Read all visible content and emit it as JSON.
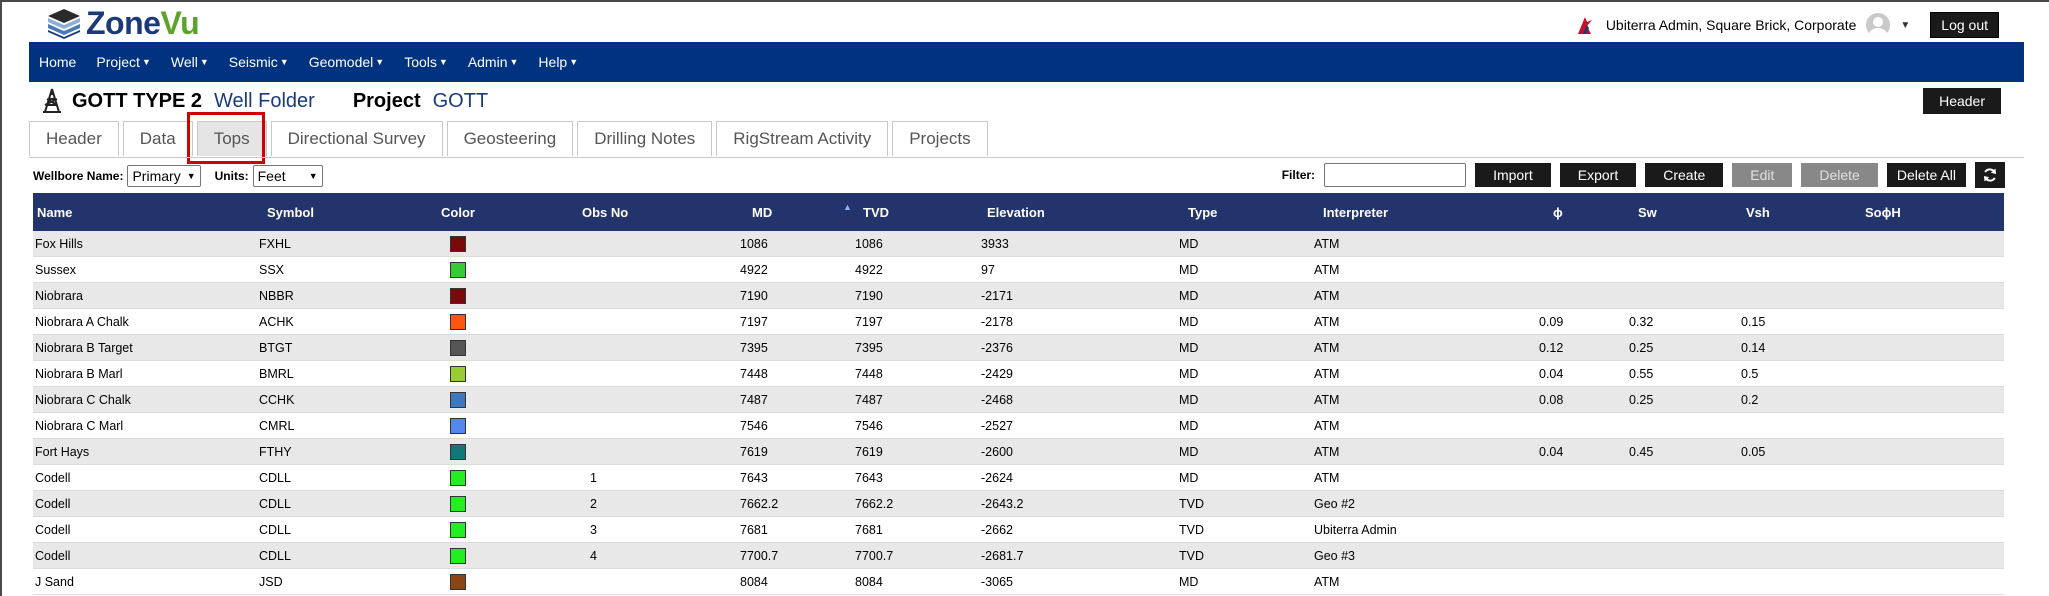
{
  "app": {
    "logo_part1": "Zone",
    "logo_part2": "Vu",
    "user_label": "Ubiterra Admin, Square Brick, Corporate",
    "logout_label": "Log out"
  },
  "nav": [
    {
      "label": "Home",
      "dropdown": false
    },
    {
      "label": "Project",
      "dropdown": true
    },
    {
      "label": "Well",
      "dropdown": true
    },
    {
      "label": "Seismic",
      "dropdown": true
    },
    {
      "label": "Geomodel",
      "dropdown": true
    },
    {
      "label": "Tools",
      "dropdown": true
    },
    {
      "label": "Admin",
      "dropdown": true
    },
    {
      "label": "Help",
      "dropdown": true
    }
  ],
  "title": {
    "well_name": "GOTT TYPE 2",
    "well_folder": "Well Folder",
    "project_label": "Project",
    "project_name": "GOTT",
    "header_button": "Header"
  },
  "tabs": [
    {
      "label": "Header",
      "active": false
    },
    {
      "label": "Data",
      "active": false
    },
    {
      "label": "Tops",
      "active": true
    },
    {
      "label": "Directional Survey",
      "active": false
    },
    {
      "label": "Geosteering",
      "active": false
    },
    {
      "label": "Drilling Notes",
      "active": false
    },
    {
      "label": "RigStream Activity",
      "active": false
    },
    {
      "label": "Projects",
      "active": false
    }
  ],
  "controls": {
    "wellbore_label": "Wellbore Name:",
    "wellbore_value": "Primary",
    "units_label": "Units:",
    "units_value": "Feet",
    "filter_label": "Filter:",
    "filter_value": "",
    "buttons": [
      {
        "label": "Import",
        "enabled": true
      },
      {
        "label": "Export",
        "enabled": true
      },
      {
        "label": "Create",
        "enabled": true
      },
      {
        "label": "Edit",
        "enabled": false
      },
      {
        "label": "Delete",
        "enabled": false
      },
      {
        "label": "Delete All",
        "enabled": true
      }
    ]
  },
  "table": {
    "columns": [
      "Name",
      "Symbol",
      "Color",
      "Obs No",
      "MD",
      "TVD",
      "Elevation",
      "Type",
      "Interpreter",
      "ϕ",
      "Sw",
      "Vsh",
      "SoϕH"
    ],
    "sorted_column": "TVD",
    "rows": [
      {
        "name": "Fox Hills",
        "symbol": "FXHL",
        "color": "#7a0a0a",
        "obs": "",
        "md": "1086",
        "tvd": "1086",
        "elev": "3933",
        "type": "MD",
        "interp": "ATM",
        "phi": "",
        "sw": "",
        "vsh": "",
        "sophih": ""
      },
      {
        "name": "Sussex",
        "symbol": "SSX",
        "color": "#33cc33",
        "obs": "",
        "md": "4922",
        "tvd": "4922",
        "elev": "97",
        "type": "MD",
        "interp": "ATM",
        "phi": "",
        "sw": "",
        "vsh": "",
        "sophih": ""
      },
      {
        "name": "Niobrara",
        "symbol": "NBBR",
        "color": "#7a0a0a",
        "obs": "",
        "md": "7190",
        "tvd": "7190",
        "elev": "-2171",
        "type": "MD",
        "interp": "ATM",
        "phi": "",
        "sw": "",
        "vsh": "",
        "sophih": ""
      },
      {
        "name": "Niobrara A Chalk",
        "symbol": "ACHK",
        "color": "#ff5511",
        "obs": "",
        "md": "7197",
        "tvd": "7197",
        "elev": "-2178",
        "type": "MD",
        "interp": "ATM",
        "phi": "0.09",
        "sw": "0.32",
        "vsh": "0.15",
        "sophih": ""
      },
      {
        "name": "Niobrara B Target",
        "symbol": "BTGT",
        "color": "#555555",
        "obs": "",
        "md": "7395",
        "tvd": "7395",
        "elev": "-2376",
        "type": "MD",
        "interp": "ATM",
        "phi": "0.12",
        "sw": "0.25",
        "vsh": "0.14",
        "sophih": ""
      },
      {
        "name": "Niobrara B Marl",
        "symbol": "BMRL",
        "color": "#99cc33",
        "obs": "",
        "md": "7448",
        "tvd": "7448",
        "elev": "-2429",
        "type": "MD",
        "interp": "ATM",
        "phi": "0.04",
        "sw": "0.55",
        "vsh": "0.5",
        "sophih": ""
      },
      {
        "name": "Niobrara C Chalk",
        "symbol": "CCHK",
        "color": "#3c78c0",
        "obs": "",
        "md": "7487",
        "tvd": "7487",
        "elev": "-2468",
        "type": "MD",
        "interp": "ATM",
        "phi": "0.08",
        "sw": "0.25",
        "vsh": "0.2",
        "sophih": ""
      },
      {
        "name": "Niobrara C Marl",
        "symbol": "CMRL",
        "color": "#5588ee",
        "obs": "",
        "md": "7546",
        "tvd": "7546",
        "elev": "-2527",
        "type": "MD",
        "interp": "ATM",
        "phi": "",
        "sw": "",
        "vsh": "",
        "sophih": ""
      },
      {
        "name": "Fort Hays",
        "symbol": "FTHY",
        "color": "#117777",
        "obs": "",
        "md": "7619",
        "tvd": "7619",
        "elev": "-2600",
        "type": "MD",
        "interp": "ATM",
        "phi": "0.04",
        "sw": "0.45",
        "vsh": "0.05",
        "sophih": ""
      },
      {
        "name": "Codell",
        "symbol": "CDLL",
        "color": "#22ee22",
        "obs": "1",
        "md": "7643",
        "tvd": "7643",
        "elev": "-2624",
        "type": "MD",
        "interp": "ATM",
        "phi": "",
        "sw": "",
        "vsh": "",
        "sophih": ""
      },
      {
        "name": "Codell",
        "symbol": "CDLL",
        "color": "#22ee22",
        "obs": "2",
        "md": "7662.2",
        "tvd": "7662.2",
        "elev": "-2643.2",
        "type": "TVD",
        "interp": "Geo #2",
        "phi": "",
        "sw": "",
        "vsh": "",
        "sophih": ""
      },
      {
        "name": "Codell",
        "symbol": "CDLL",
        "color": "#22ee22",
        "obs": "3",
        "md": "7681",
        "tvd": "7681",
        "elev": "-2662",
        "type": "TVD",
        "interp": "Ubiterra Admin",
        "phi": "",
        "sw": "",
        "vsh": "",
        "sophih": ""
      },
      {
        "name": "Codell",
        "symbol": "CDLL",
        "color": "#22ee22",
        "obs": "4",
        "md": "7700.7",
        "tvd": "7700.7",
        "elev": "-2681.7",
        "type": "TVD",
        "interp": "Geo #3",
        "phi": "",
        "sw": "",
        "vsh": "",
        "sophih": ""
      },
      {
        "name": "J Sand",
        "symbol": "JSD",
        "color": "#8b4513",
        "obs": "",
        "md": "8084",
        "tvd": "8084",
        "elev": "-3065",
        "type": "MD",
        "interp": "ATM",
        "phi": "",
        "sw": "",
        "vsh": "",
        "sophih": ""
      }
    ]
  }
}
